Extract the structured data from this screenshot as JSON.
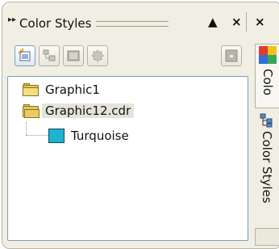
{
  "docker": {
    "title": "Color Styles",
    "buttons": {
      "collapse": "▲",
      "close": "×",
      "close_partial": "×"
    }
  },
  "toolbar": {
    "tools": [
      {
        "icon": "new-style-icon",
        "active": true
      },
      {
        "icon": "new-child-icon",
        "active": false
      },
      {
        "icon": "palette-icon",
        "active": false
      },
      {
        "icon": "auto-create-icon",
        "active": false
      },
      {
        "icon": "options-icon",
        "active": false
      }
    ]
  },
  "tree": {
    "items": [
      {
        "label": "Graphic1",
        "icon": "folder-icon",
        "selected": false
      },
      {
        "label": "Graphic12.cdr",
        "icon": "folder-open-icon",
        "selected": true
      },
      {
        "label": "Turquoise",
        "icon": "color-swatch-icon",
        "color": "#1cb4cf",
        "selected": false
      }
    ]
  },
  "side_tabs": [
    {
      "label": "Colo"
    },
    {
      "label": "Color Styles"
    }
  ],
  "colors": {
    "frame": "#f1efe4",
    "tree_border": "#7f9db9",
    "swatch": "#1cb4cf"
  }
}
